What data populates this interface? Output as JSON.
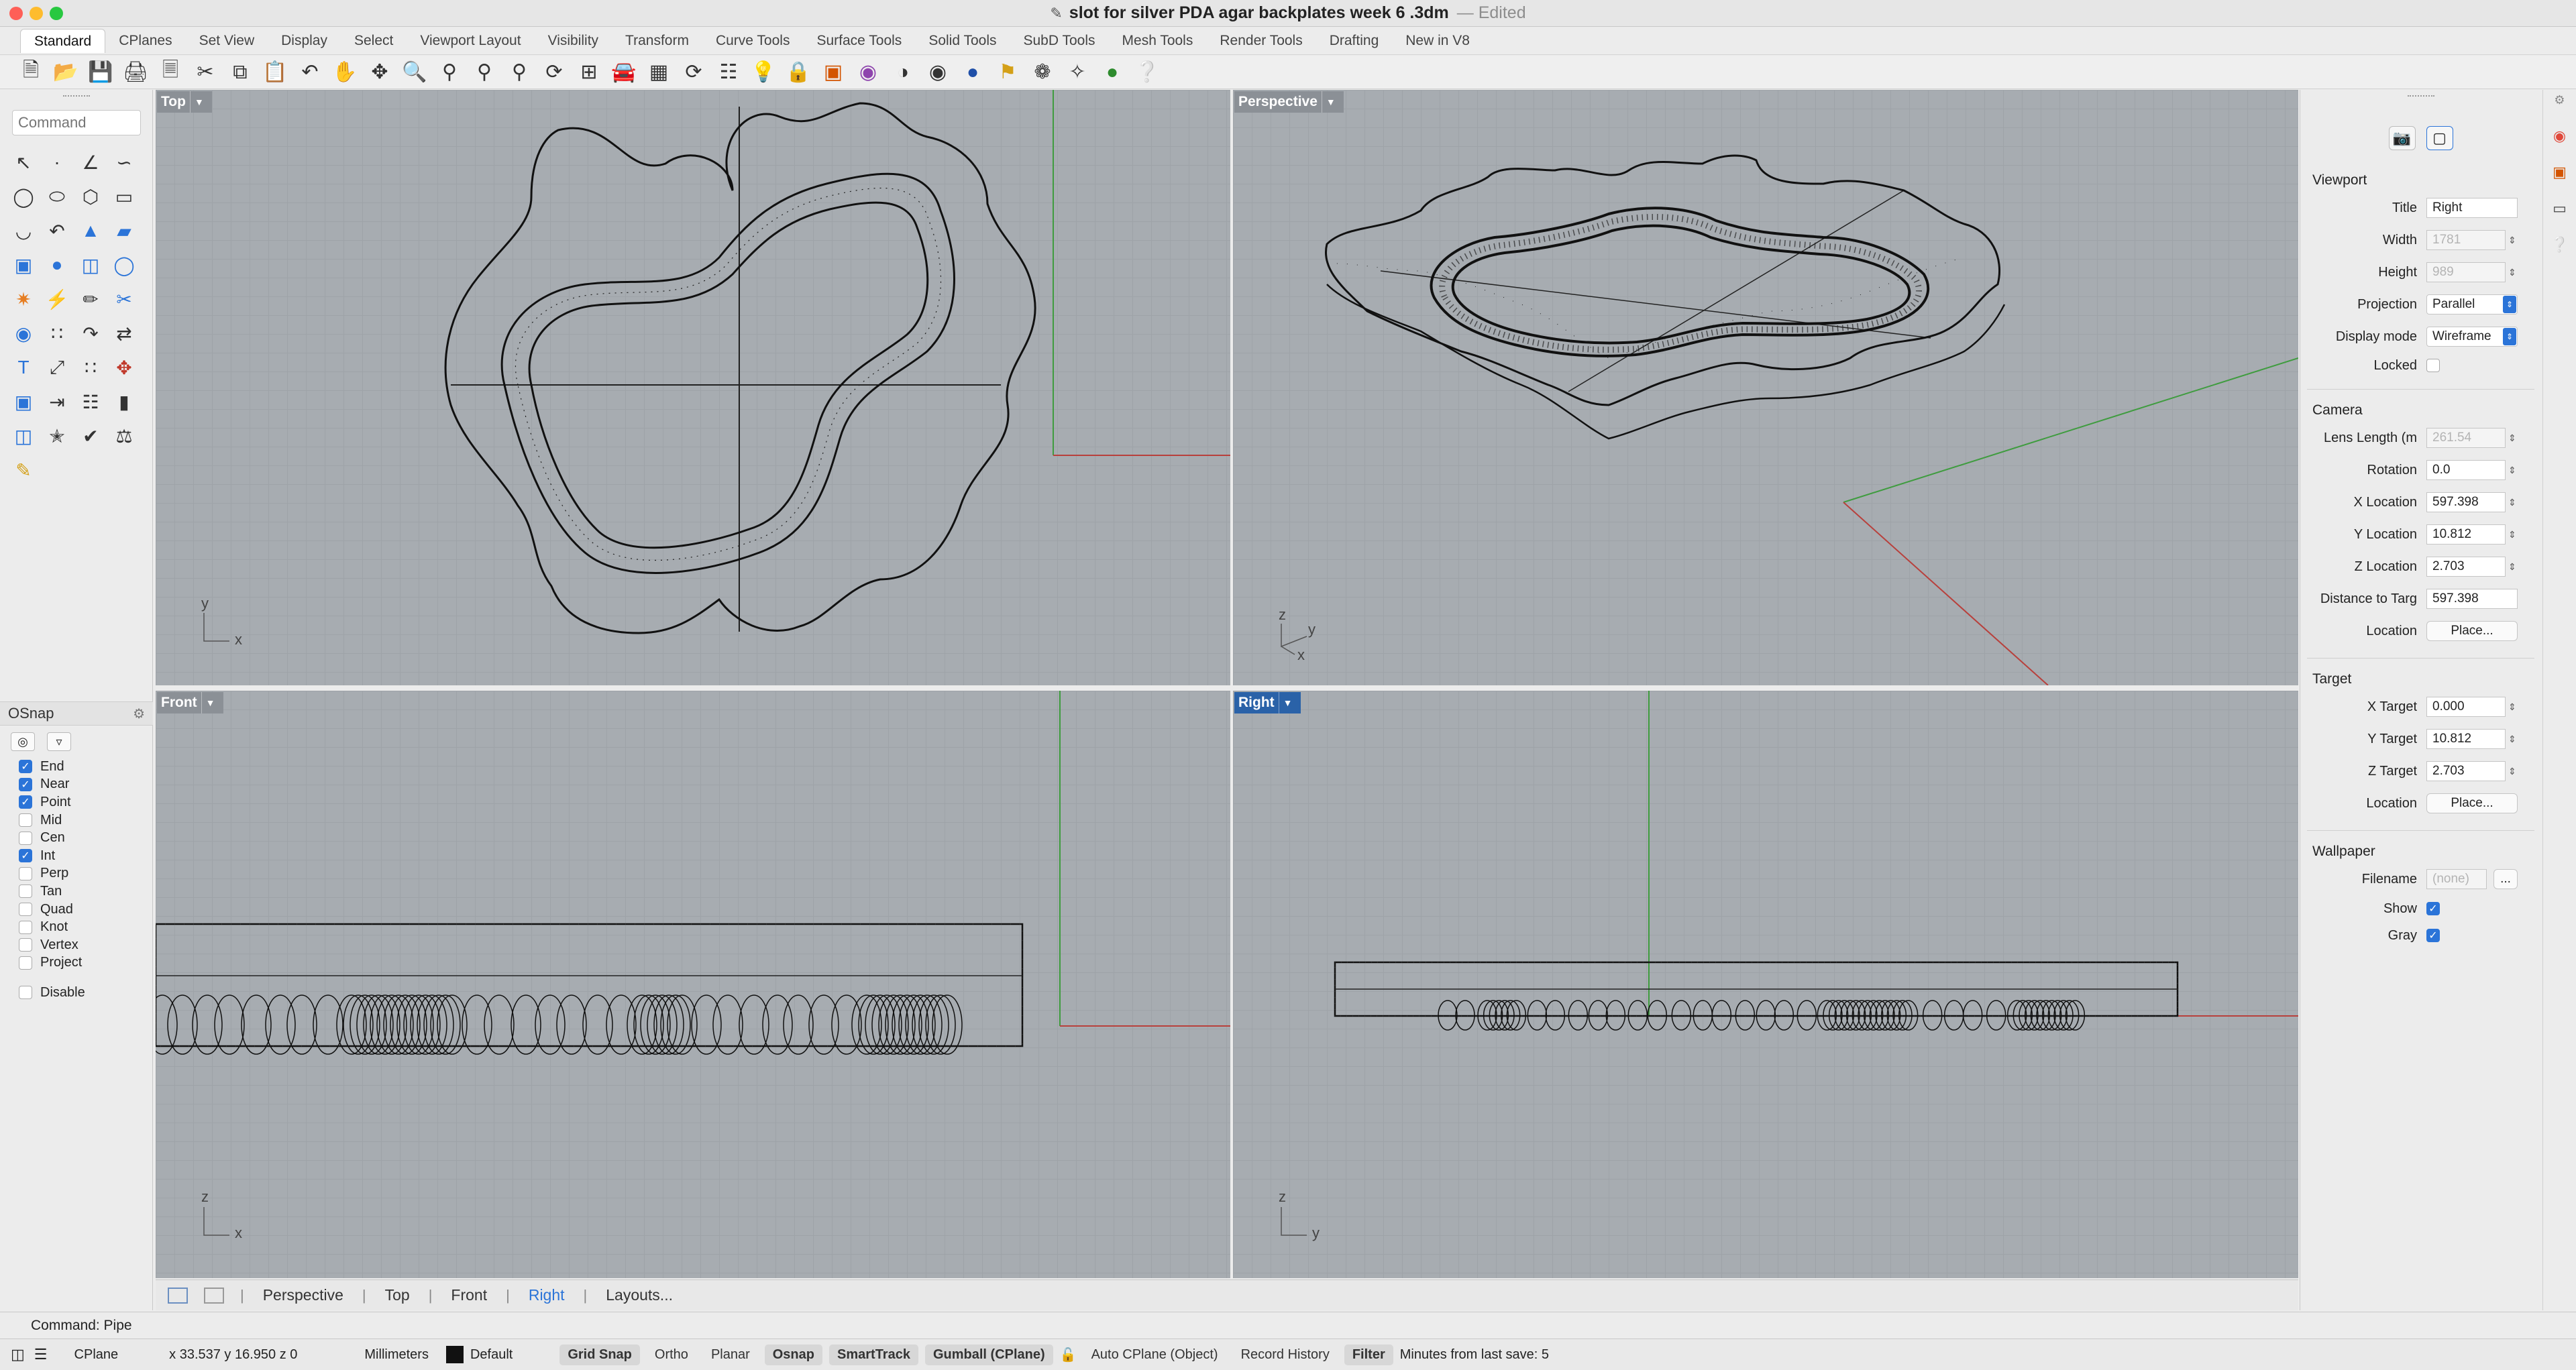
{
  "window": {
    "title": "slot for silver PDA agar backplates week 6 .3dm",
    "edited": "— Edited",
    "traffic_colors": [
      "#fe5f57",
      "#febc2e",
      "#28c840"
    ]
  },
  "tabs": [
    "Standard",
    "CPlanes",
    "Set View",
    "Display",
    "Select",
    "Viewport Layout",
    "Visibility",
    "Transform",
    "Curve Tools",
    "Surface Tools",
    "Solid Tools",
    "SubD Tools",
    "Mesh Tools",
    "Render Tools",
    "Drafting",
    "New in V8"
  ],
  "toolbar_icons": [
    "new-file",
    "open-file",
    "save",
    "print",
    "import",
    "cut",
    "copy",
    "paste",
    "undo",
    "pan",
    "move-view",
    "zoom",
    "zoom-window",
    "zoom-extents",
    "zoom-selected",
    "four-viewports",
    "car-icon",
    "cplane",
    "rotate-view",
    "snap-grid",
    "lightbulb",
    "lock",
    "layers",
    "color-wheel",
    "shaded",
    "render",
    "materials",
    "blue-sphere",
    "flag",
    "osnap",
    "gumball",
    "green-sphere",
    "help"
  ],
  "command": {
    "placeholder": "Command",
    "history": "Command: Pipe"
  },
  "osnap": {
    "title": "OSnap",
    "items": [
      {
        "label": "End",
        "checked": true
      },
      {
        "label": "Near",
        "checked": true
      },
      {
        "label": "Point",
        "checked": true
      },
      {
        "label": "Mid",
        "checked": false
      },
      {
        "label": "Cen",
        "checked": false
      },
      {
        "label": "Int",
        "checked": true
      },
      {
        "label": "Perp",
        "checked": false
      },
      {
        "label": "Tan",
        "checked": false
      },
      {
        "label": "Quad",
        "checked": false
      },
      {
        "label": "Knot",
        "checked": false
      },
      {
        "label": "Vertex",
        "checked": false
      },
      {
        "label": "Project",
        "checked": false
      }
    ],
    "disable_label": "Disable"
  },
  "viewports": {
    "top": {
      "name": "Top",
      "axis_v": "y",
      "axis_h": "x"
    },
    "perspective": {
      "name": "Perspective",
      "axis_v": "z",
      "axis_a": "y",
      "axis_h": "x"
    },
    "front": {
      "name": "Front",
      "axis_v": "z",
      "axis_h": "x"
    },
    "right": {
      "name": "Right",
      "axis_v": "z",
      "axis_h": "y"
    }
  },
  "viewport_tabs": [
    "Perspective",
    "Top",
    "Front",
    "Right",
    "Layouts..."
  ],
  "viewport_active_tab": "Right",
  "properties": {
    "viewport_section": "Viewport",
    "title_label": "Title",
    "title_value": "Right",
    "width_label": "Width",
    "width_value": "1781",
    "height_label": "Height",
    "height_value": "989",
    "projection_label": "Projection",
    "projection_value": "Parallel",
    "display_label": "Display mode",
    "display_value": "Wireframe",
    "locked_label": "Locked",
    "camera_section": "Camera",
    "lens_label": "Lens Length (m",
    "lens_value": "261.54",
    "rotation_label": "Rotation",
    "rotation_value": "0.0",
    "xloc_label": "X Location",
    "xloc_value": "597.398",
    "yloc_label": "Y Location",
    "yloc_value": "10.812",
    "zloc_label": "Z Location",
    "zloc_value": "2.703",
    "dist_label": "Distance to Targ",
    "dist_value": "597.398",
    "location_label": "Location",
    "place_label": "Place...",
    "target_section": "Target",
    "xt_label": "X Target",
    "xt_value": "0.000",
    "yt_label": "Y Target",
    "yt_value": "10.812",
    "zt_label": "Z Target",
    "zt_value": "2.703",
    "tloc_label": "Location",
    "tplace_label": "Place...",
    "wallpaper_section": "Wallpaper",
    "filename_label": "Filename",
    "filename_value": "(none)",
    "browse_label": "...",
    "show_label": "Show",
    "gray_label": "Gray"
  },
  "status": {
    "cplane": "CPlane",
    "coords": "x 33.537   y 16.950   z 0",
    "units": "Millimeters",
    "layer": "Default",
    "grid_snap": "Grid Snap",
    "ortho": "Ortho",
    "planar": "Planar",
    "osnap": "Osnap",
    "smarttrack": "SmartTrack",
    "gumball": "Gumball (CPlane)",
    "auto_cplane": "Auto CPlane (Object)",
    "record_history": "Record History",
    "filter": "Filter",
    "last_save": "Minutes from last save: 5"
  },
  "colors": {
    "viewport_bg": "#a7acb1",
    "grid_line": "#9ea3a8",
    "active_blue": "#2a62a8",
    "x_axis": "#b8403c",
    "y_axis": "#3f9c3f"
  }
}
